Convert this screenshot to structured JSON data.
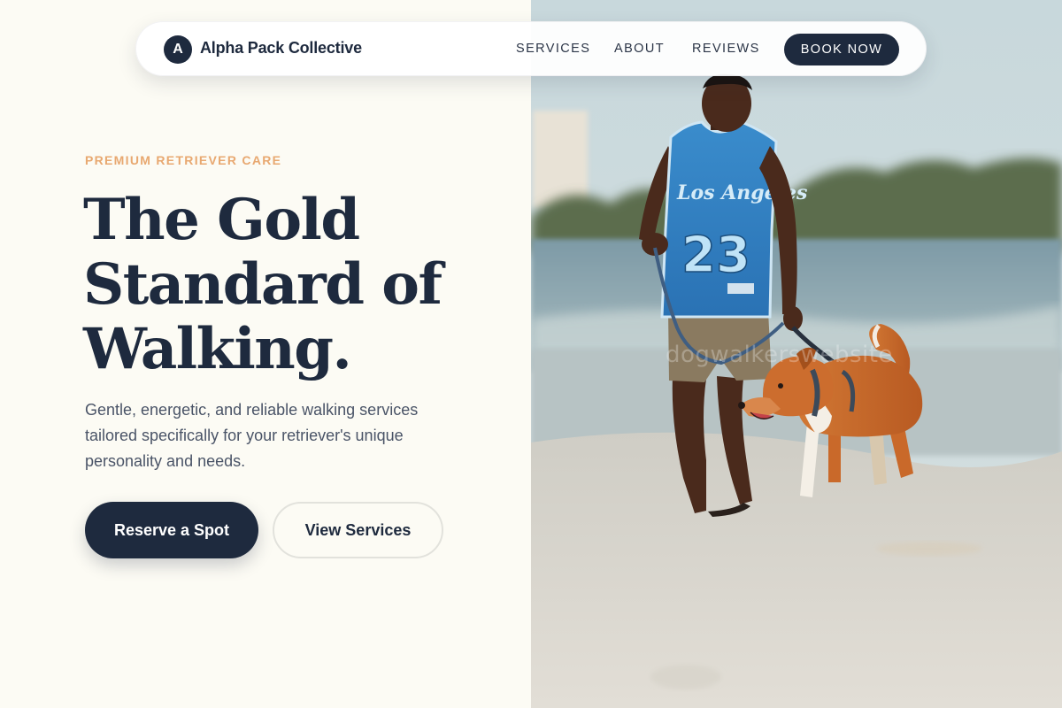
{
  "brand": {
    "logo_letter": "A",
    "name": "Alpha Pack Collective"
  },
  "nav": {
    "links": [
      "SERVICES",
      "ABOUT",
      "REVIEWS"
    ],
    "cta": "BOOK NOW"
  },
  "hero": {
    "eyebrow": "PREMIUM RETRIEVER CARE",
    "title_lines": [
      "The Gold",
      "Standard of",
      "Walking."
    ],
    "subtitle": "Gentle, energetic, and reliable walking services tailored specifically for your retriever's unique personality and needs.",
    "primary_button": "Reserve a Spot",
    "secondary_button": "View Services"
  },
  "photo": {
    "jersey_text": "Los Angeles",
    "jersey_number": "23",
    "watermark": "dogwalkerswebsite"
  },
  "colors": {
    "page_bg": "#fcfbf4",
    "navy": "#1e2a3e",
    "accent": "#e8a870",
    "jersey_blue": "#2f7fc0",
    "dog_orange": "#c9692a"
  }
}
